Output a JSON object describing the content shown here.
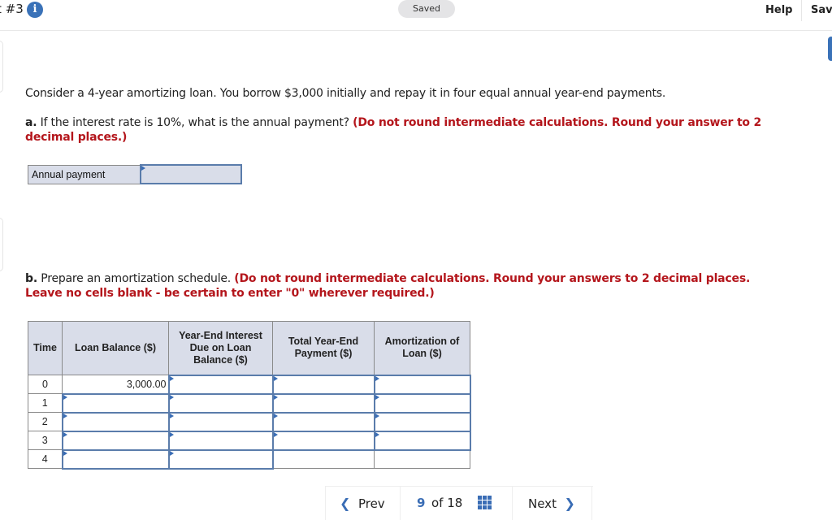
{
  "header": {
    "title": "t #3",
    "info_icon": "info-icon",
    "status": "Saved",
    "help": "Help",
    "save": "Save"
  },
  "question": {
    "intro": "Consider a 4-year amortizing loan. You borrow $3,000 initially and repay it in four equal annual year-end payments.",
    "part_a": {
      "label": "a.",
      "text": " If the interest rate is 10%, what is the annual payment? ",
      "instruction": "(Do not round intermediate calculations. Round your answer to 2 decimal places.)",
      "answer_label": "Annual payment",
      "answer_value": ""
    },
    "part_b": {
      "label": "b.",
      "text": " Prepare an amortization schedule. ",
      "instruction": "(Do not round intermediate calculations. Round your answers to 2 decimal places. Leave no cells blank - be certain to enter \"0\" wherever required.)"
    }
  },
  "schedule": {
    "headers": [
      "Time",
      "Loan Balance ($)",
      "Year-End Interest Due on Loan Balance ($)",
      "Total Year-End Payment ($)",
      "Amortization of Loan ($)"
    ],
    "rows": [
      {
        "time": "0",
        "balance": "3,000.00",
        "interest": "",
        "payment": "",
        "amortization": ""
      },
      {
        "time": "1",
        "balance": "",
        "interest": "",
        "payment": "",
        "amortization": ""
      },
      {
        "time": "2",
        "balance": "",
        "interest": "",
        "payment": "",
        "amortization": ""
      },
      {
        "time": "3",
        "balance": "",
        "interest": "",
        "payment": "",
        "amortization": ""
      },
      {
        "time": "4",
        "balance": "",
        "interest": "",
        "payment": "",
        "amortization": ""
      }
    ]
  },
  "footer": {
    "prev": "Prev",
    "current_page": "9",
    "of_total": "of 18",
    "next": "Next"
  },
  "colors": {
    "accent": "#3a6db5",
    "instruction_red": "#b4161c",
    "cell_header_bg": "#d9dde9"
  }
}
